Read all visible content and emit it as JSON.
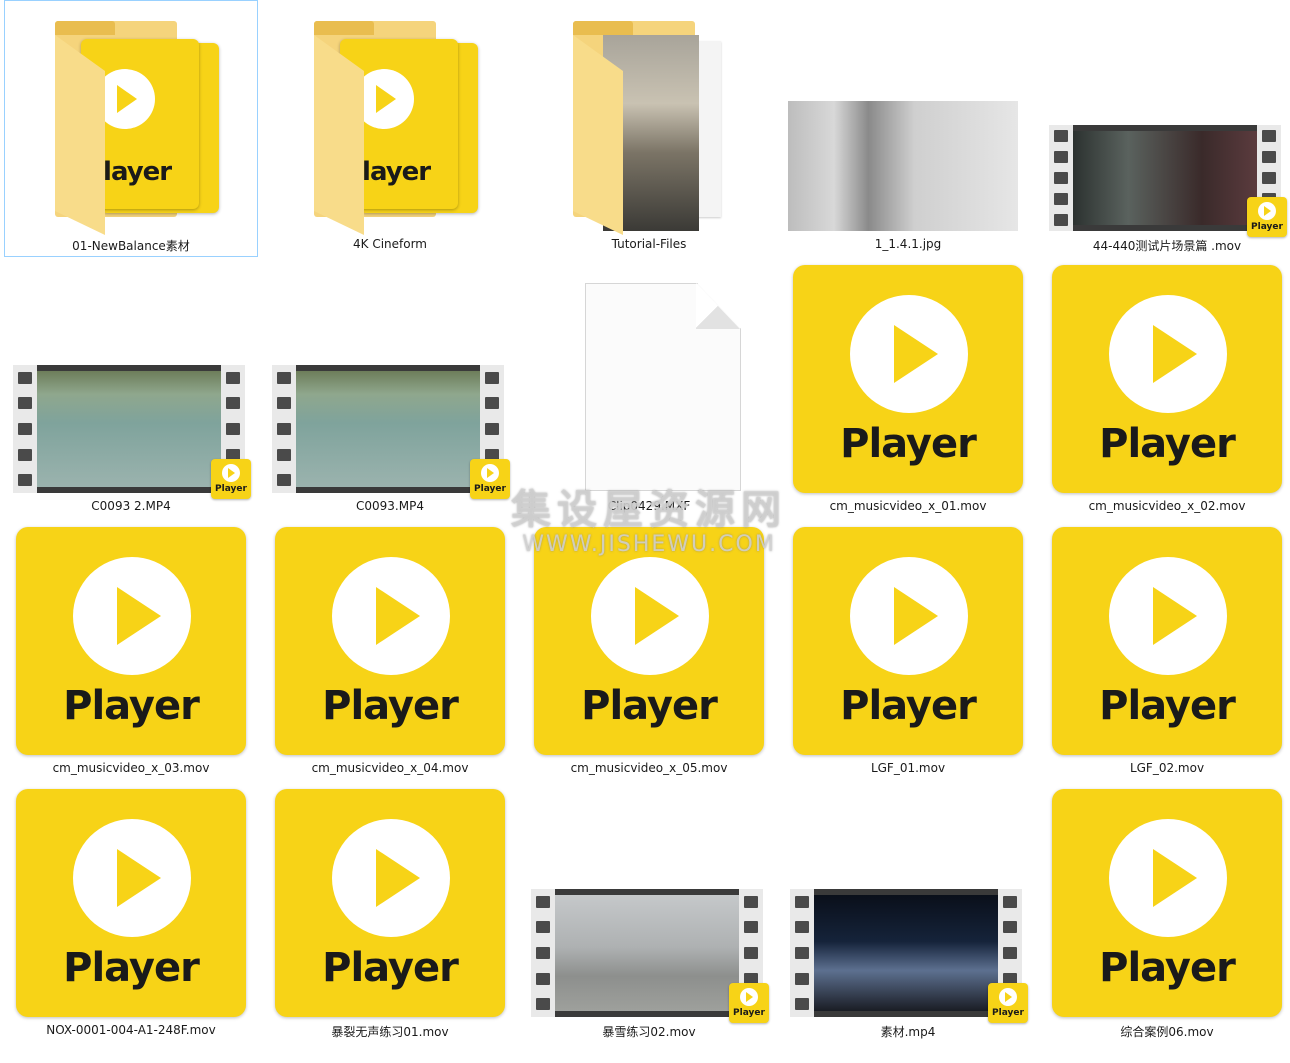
{
  "files": [
    {
      "name": "01-NewBalance素材",
      "kind": "folder-player",
      "selected": true
    },
    {
      "name": "4K Cineform",
      "kind": "folder-player"
    },
    {
      "name": "Tutorial-Files",
      "kind": "folder-photo"
    },
    {
      "name": "1_1.4.1.jpg",
      "kind": "photo"
    },
    {
      "name": "44-440测试片场景篇 .mov",
      "kind": "film-dark"
    },
    {
      "name": "C0093 2.MP4",
      "kind": "film-water"
    },
    {
      "name": "C0093.MP4",
      "kind": "film-water"
    },
    {
      "name": "Clip0429.MXF",
      "kind": "blank"
    },
    {
      "name": "cm_musicvideo_x_01.mov",
      "kind": "player"
    },
    {
      "name": "cm_musicvideo_x_02.mov",
      "kind": "player"
    },
    {
      "name": "cm_musicvideo_x_03.mov",
      "kind": "player"
    },
    {
      "name": "cm_musicvideo_x_04.mov",
      "kind": "player"
    },
    {
      "name": "cm_musicvideo_x_05.mov",
      "kind": "player"
    },
    {
      "name": "LGF_01.mov",
      "kind": "player"
    },
    {
      "name": "LGF_02.mov",
      "kind": "player"
    },
    {
      "name": "NOX-0001-004-A1-248F.mov",
      "kind": "player"
    },
    {
      "name": "暴裂无声练习01.mov",
      "kind": "player"
    },
    {
      "name": "暴雪练习02.mov",
      "kind": "film-street"
    },
    {
      "name": "素材.mp4",
      "kind": "film-car"
    },
    {
      "name": "综合案例06.mov",
      "kind": "player"
    }
  ],
  "player_word": "Player",
  "watermark": {
    "line1": "集设屋资源网",
    "line2": "WWW.JISHEWU.COM"
  },
  "colors": {
    "player_yellow": "#f7d317",
    "selection": "#99d1ff"
  }
}
